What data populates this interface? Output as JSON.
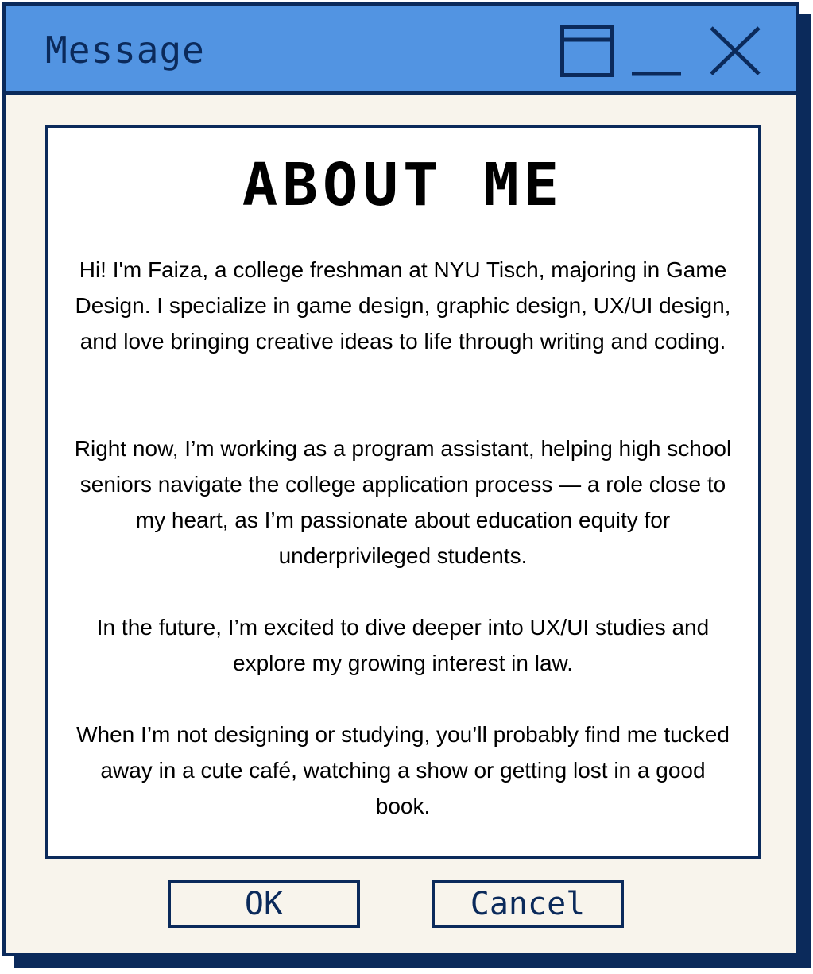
{
  "window": {
    "title": "Message"
  },
  "controls": {
    "maximize_icon": "maximize-icon",
    "minimize_icon": "minimize-icon",
    "close_icon": "close-icon"
  },
  "content": {
    "heading": "ABOUT ME",
    "paragraphs": [
      "Hi! I'm Faiza, a college freshman at NYU Tisch, majoring in Game Design. I specialize in game design, graphic design, UX/UI design, and love bringing creative ideas to life through writing and coding.",
      "Right now, I’m working as a program assistant, helping high school seniors navigate the college application process — a role close to my heart, as I’m passionate about education equity for underprivileged students.",
      "In the future, I’m excited to dive deeper into UX/UI studies and explore my growing interest in law.",
      "When I’m not designing or studying, you’ll probably find me tucked away in a cute café, watching a show or getting lost in a good book."
    ]
  },
  "buttons": {
    "ok_label": "OK",
    "cancel_label": "Cancel"
  },
  "colors": {
    "titlebar": "#5294e2",
    "border": "#0b2a5b",
    "window_bg": "#f8f4ec",
    "content_bg": "#ffffff"
  }
}
